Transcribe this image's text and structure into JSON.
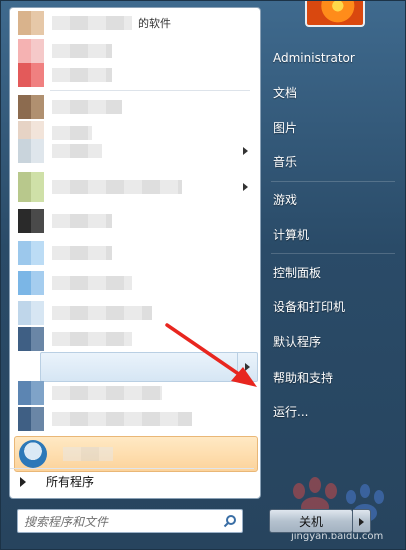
{
  "program_list": {
    "top_label_fragment": "的软件",
    "items": [
      {
        "icon_colors": [
          "#d9b38c",
          "#e6c8a8"
        ],
        "has_arrow": false
      },
      {
        "icon_colors": [
          "#f5b2b2",
          "#f5c9c9"
        ],
        "has_arrow": false
      },
      {
        "icon_colors": [
          "#e35a5a",
          "#f08080"
        ],
        "has_arrow": false
      },
      {
        "icon_colors": [
          "#8c6b4f",
          "#b09070"
        ],
        "has_arrow": false
      },
      {
        "icon_colors": [
          "#e6d3c5",
          "#f2e4da"
        ],
        "has_arrow": false
      },
      {
        "icon_colors": [
          "#c9d4dc",
          "#dfe6ec"
        ],
        "has_arrow": true
      },
      {
        "icon_colors": [
          "#b8c88c",
          "#cfe0a8"
        ],
        "has_arrow": true
      },
      {
        "icon_colors": [
          "#9fb5c6",
          "#c2d2de"
        ],
        "has_arrow": false
      },
      {
        "icon_colors": [
          "#2a2a2a",
          "#4a4a4a"
        ],
        "has_arrow": false
      },
      {
        "icon_colors": [
          "#9cc8ec",
          "#bcdcf5"
        ],
        "has_arrow": false
      },
      {
        "icon_colors": [
          "#7bb6e6",
          "#a5cdef"
        ],
        "has_arrow": false
      },
      {
        "icon_colors": [
          "#bfd6ea",
          "#d7e6f3"
        ],
        "has_arrow": false
      },
      {
        "icon_colors": [
          "#5c85b2",
          "#7fa3c8"
        ],
        "has_arrow": false
      },
      {
        "icon_colors": [
          "#3f5f84",
          "#6a86a6"
        ],
        "has_arrow": false
      }
    ]
  },
  "all_programs": {
    "label": "所有程序"
  },
  "search": {
    "placeholder": "搜索程序和文件"
  },
  "right_pane": {
    "items": [
      {
        "label": "Administrator",
        "name": "right-item-administrator"
      },
      {
        "label": "文档",
        "name": "right-item-documents"
      },
      {
        "label": "图片",
        "name": "right-item-pictures"
      },
      {
        "label": "音乐",
        "name": "right-item-music"
      },
      {
        "label": "游戏",
        "name": "right-item-games"
      },
      {
        "label": "计算机",
        "name": "right-item-computer"
      },
      {
        "label": "控制面板",
        "name": "right-item-control-panel"
      },
      {
        "label": "设备和打印机",
        "name": "right-item-devices-printers"
      },
      {
        "label": "默认程序",
        "name": "right-item-default-programs"
      },
      {
        "label": "帮助和支持",
        "name": "right-item-help-support"
      },
      {
        "label": "运行...",
        "name": "right-item-run"
      }
    ]
  },
  "shutdown": {
    "label": "关机"
  },
  "watermark": {
    "text": "jingyan.baidu.com"
  },
  "colors": {
    "annotation_arrow": "#e8261f",
    "highlight": "#fcd39b",
    "right_pane_bg": "#2a4b68"
  }
}
